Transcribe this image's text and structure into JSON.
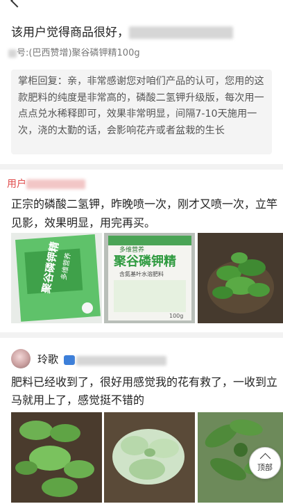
{
  "review1": {
    "text": "该用户觉得商品很好，",
    "sku_prefix": "号:(巴西赞增)聚谷磷钾精100g",
    "reply": "掌柜回复：亲，非常感谢您对咱们产品的认可，您用的这款肥料的纯度是非常高的，磷酸二氢钾升级版，每次用一点点兑水稀释即可，效果非常明显，间隔7-10天施用一次，浇的太勤的话，会影响花卉或者盆栽的生长"
  },
  "review2": {
    "user_partial": "用户",
    "text": "正宗的磷酸二氢钾，昨晚喷一次，刚才又喷一次，立竿见影，效果明显，用完再买。",
    "images": [
      {
        "name": "product-photo-green-pack",
        "labels": [
          "聚谷磷钾精",
          "多维营养"
        ]
      },
      {
        "name": "product-photo-white-pack",
        "labels": [
          "多维营养",
          "聚谷磷钾精",
          "含氮基叶水溶肥料",
          "100g"
        ]
      },
      {
        "name": "plant-photo"
      }
    ]
  },
  "review3": {
    "username": "玲歌",
    "text": "肥料已经收到了，很好用感觉我的花有救了，一收到立马就用上了，感觉挺不错的",
    "images": [
      {
        "name": "plant-photo-1"
      },
      {
        "name": "plant-photo-2"
      },
      {
        "name": "plant-photo-3"
      }
    ]
  },
  "top_button": {
    "label": "顶部"
  }
}
